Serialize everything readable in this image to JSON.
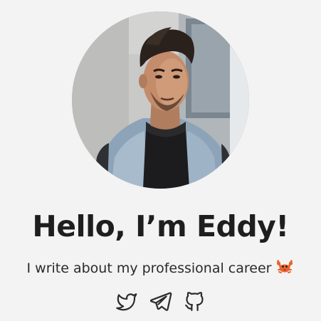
{
  "profile": {
    "greeting": "Hello, I’m Eddy!",
    "tagline": "I write about my professional career",
    "tagline_emoji_icon": "crab-icon",
    "avatar_icon": "profile-photo"
  },
  "socials": [
    {
      "icon": "twitter-icon"
    },
    {
      "icon": "telegram-icon"
    },
    {
      "icon": "github-icon"
    }
  ],
  "colors": {
    "background": "#f3f3f3",
    "text": "#1e1e1e",
    "crab": "#e8632f"
  }
}
